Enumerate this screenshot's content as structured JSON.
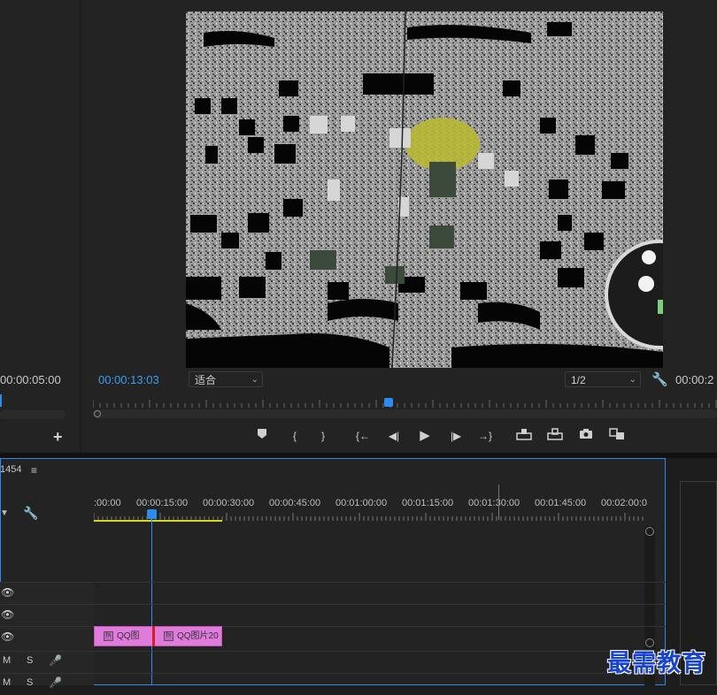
{
  "source_monitor": {
    "timecode": "00:00:05:00",
    "add_button": "+"
  },
  "program_monitor": {
    "current_timecode": "00:00:13:03",
    "fit_select": "适合",
    "resolution_select": "1/2",
    "duration_timecode": "00:00:2",
    "controls": {
      "add_marker": "marker-icon",
      "mark_in": "{",
      "mark_out": "}",
      "go_to_in": "{←",
      "step_back": "◀|",
      "play": "▶",
      "step_forward": "|▶",
      "go_to_out": "→}",
      "lift": "lift-icon",
      "extract": "extract-icon",
      "export_frame": "camera-icon",
      "compare": "compare-icon"
    }
  },
  "timeline": {
    "sequence_name": "1454",
    "menu_icon": "≡",
    "ruler_ticks": [
      ":00:00",
      "00:00:15:00",
      "00:00:30:00",
      "00:00:45:00",
      "00:01:00:00",
      "00:01:15:00",
      "00:01:30:00",
      "00:01:45:00",
      "00:02:00:0"
    ],
    "tracks": [
      {
        "type": "video",
        "eye": "👁"
      },
      {
        "type": "video",
        "eye": "👁"
      },
      {
        "type": "video",
        "eye": "👁"
      },
      {
        "type": "audio",
        "m": "M",
        "s": "S"
      },
      {
        "type": "audio",
        "m": "M",
        "s": "S"
      }
    ],
    "clips": [
      {
        "label": "QQ图"
      },
      {
        "label": "QQ图片20"
      }
    ]
  },
  "watermark": "最需教育",
  "colors": {
    "accent": "#2d8ceb",
    "clip": "#e07bdc",
    "workarea": "#d8d81a"
  }
}
